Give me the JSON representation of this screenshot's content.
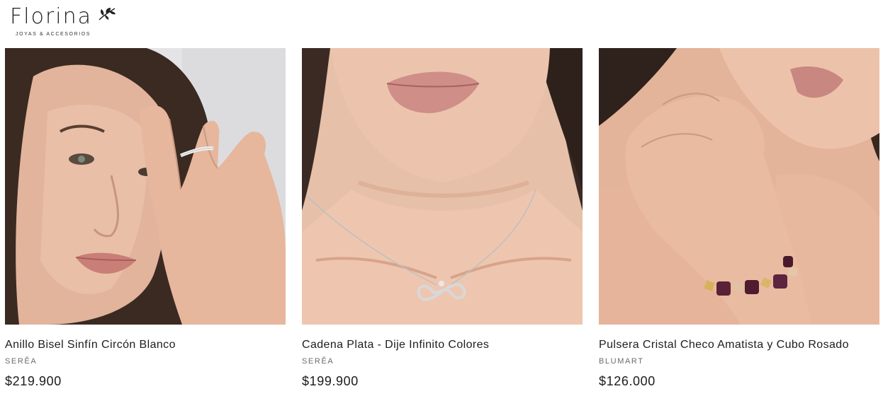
{
  "header": {
    "logo_text": "Florina",
    "logo_tagline": "JOYAS & ACCESORIOS"
  },
  "products": [
    {
      "name": "Anillo Bisel Sinfín Circón Blanco",
      "brand": "SERĚA",
      "price": "$219.900",
      "photo": "woman-wearing-ring"
    },
    {
      "name": "Cadena Plata - Dije Infinito Colores",
      "brand": "SERĚA",
      "price": "$199.900",
      "photo": "woman-wearing-infinity-necklace"
    },
    {
      "name": "Pulsera Cristal Checo Amatista y Cubo Rosado",
      "brand": "BLUMART",
      "price": "$126.000",
      "photo": "woman-wearing-bracelet"
    }
  ]
}
